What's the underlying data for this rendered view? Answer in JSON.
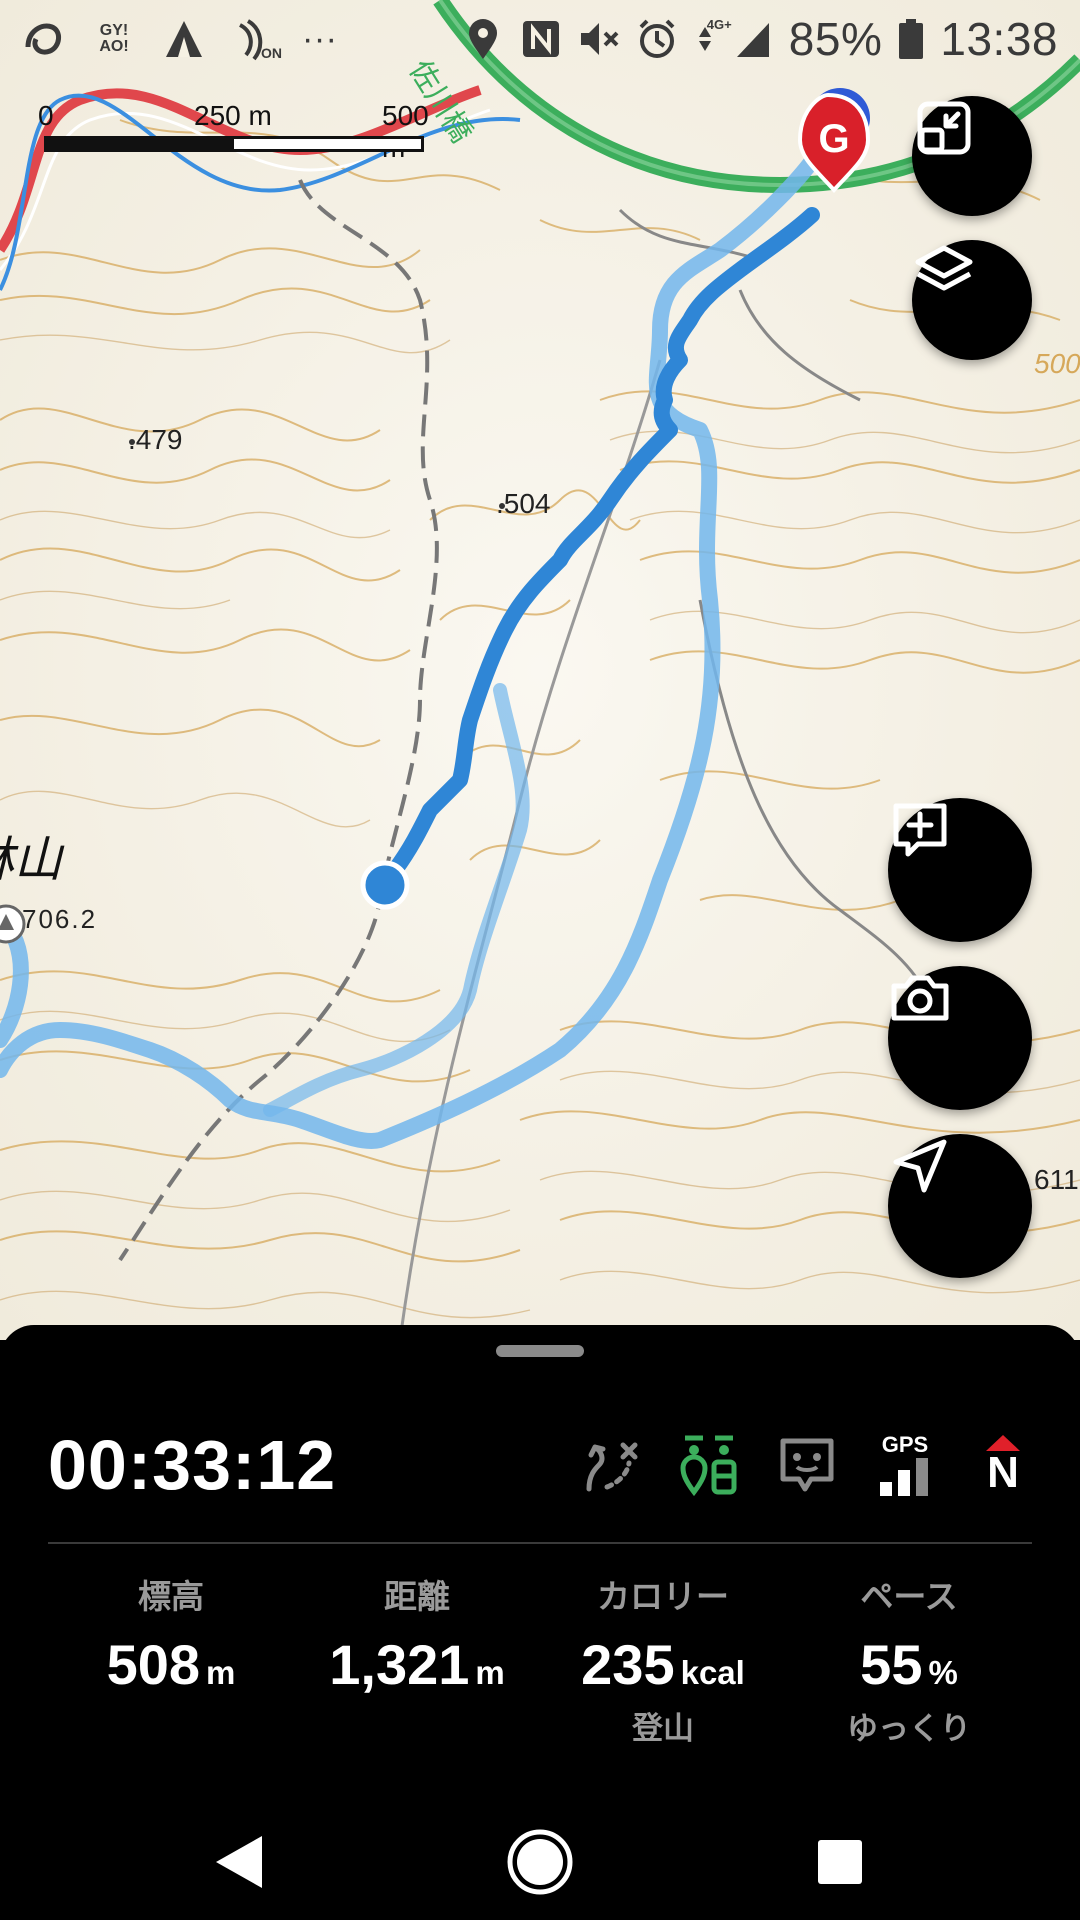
{
  "status_bar": {
    "left_icons": [
      "app-logo-icon",
      "gyao-icon",
      "tent-icon",
      "nfc-on-icon",
      "more-dots-icon"
    ],
    "gyao_text": "GY! AO!",
    "on_text": "ON",
    "more_text": "···",
    "right_icons": [
      "location-icon",
      "nfc-icon",
      "mute-icon",
      "alarm-icon",
      "data-arrows-icon",
      "signal-icon",
      "battery-icon"
    ],
    "network_label": "4G+",
    "battery_percent": "85%",
    "time": "13:38"
  },
  "map": {
    "scale": {
      "label_0": "0",
      "label_mid": "250 m",
      "label_max": "500 m"
    },
    "labels": {
      "peak_479": ".479",
      "peak_504": ".504",
      "peak_706": "706.2",
      "mountain_kanji": "林山",
      "river_name": "佐川橋",
      "right_edge_500": "500",
      "right_edge_611": "611"
    },
    "goal_marker": "G",
    "colors": {
      "track_done": "#2f86d6",
      "track_planned": "#6fb4ea",
      "road_green": "#3cae5c",
      "road_red": "#e0474c",
      "river": "#3b8fe0",
      "goal_red": "#d9202a",
      "contour": "#d4a253"
    }
  },
  "map_buttons": {
    "fit_route": "fit-route-icon",
    "layers": "layers-icon",
    "add_memo": "add-memo-icon",
    "camera": "camera-icon",
    "navigate": "navigation-arrow-icon"
  },
  "panel": {
    "timer": "00:33:12",
    "icons": [
      "route-off-icon",
      "group-icon",
      "avatar-face-icon",
      "gps-signal-icon",
      "north-icon"
    ],
    "gps_label": "GPS",
    "north_label": "N",
    "stats": [
      {
        "label": "標高",
        "value": "508",
        "unit": "m",
        "sub": ""
      },
      {
        "label": "距離",
        "value": "1,321",
        "unit": "m",
        "sub": ""
      },
      {
        "label": "カロリー",
        "value": "235",
        "unit": "kcal",
        "sub": "登山"
      },
      {
        "label": "ペース",
        "value": "55",
        "unit": "%",
        "sub": "ゆっくり"
      }
    ]
  },
  "nav_bar": {
    "back": "back-icon",
    "home": "home-icon",
    "recents": "recents-icon"
  }
}
